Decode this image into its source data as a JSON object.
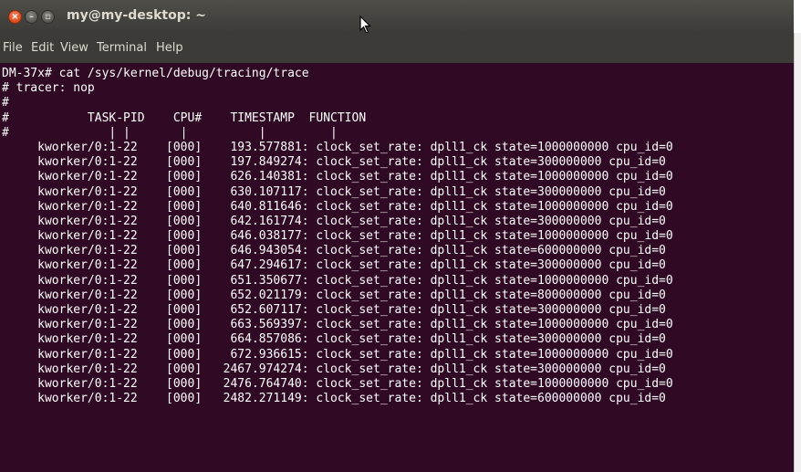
{
  "window": {
    "title": "my@my-desktop: ~",
    "close_icon": "close-icon",
    "minimize_icon": "minimize-icon",
    "maximize_icon": "maximize-icon"
  },
  "menu": [
    "File",
    "Edit",
    "View",
    "Terminal",
    "Help"
  ],
  "terminal": {
    "background": "#300a24",
    "lines": [
      "DM-37x# cat /sys/kernel/debug/tracing/trace",
      "# tracer: nop",
      "#",
      "#           TASK-PID    CPU#    TIMESTAMP  FUNCTION",
      "#              | |       |          |         |",
      "     kworker/0:1-22    [000]    193.577881: clock_set_rate: dpll1_ck state=1000000000 cpu_id=0",
      "     kworker/0:1-22    [000]    197.849274: clock_set_rate: dpll1_ck state=300000000 cpu_id=0",
      "     kworker/0:1-22    [000]    626.140381: clock_set_rate: dpll1_ck state=1000000000 cpu_id=0",
      "     kworker/0:1-22    [000]    630.107117: clock_set_rate: dpll1_ck state=300000000 cpu_id=0",
      "     kworker/0:1-22    [000]    640.811646: clock_set_rate: dpll1_ck state=1000000000 cpu_id=0",
      "     kworker/0:1-22    [000]    642.161774: clock_set_rate: dpll1_ck state=300000000 cpu_id=0",
      "     kworker/0:1-22    [000]    646.038177: clock_set_rate: dpll1_ck state=1000000000 cpu_id=0",
      "     kworker/0:1-22    [000]    646.943054: clock_set_rate: dpll1_ck state=600000000 cpu_id=0",
      "     kworker/0:1-22    [000]    647.294617: clock_set_rate: dpll1_ck state=300000000 cpu_id=0",
      "     kworker/0:1-22    [000]    651.350677: clock_set_rate: dpll1_ck state=1000000000 cpu_id=0",
      "     kworker/0:1-22    [000]    652.021179: clock_set_rate: dpll1_ck state=800000000 cpu_id=0",
      "     kworker/0:1-22    [000]    652.607117: clock_set_rate: dpll1_ck state=300000000 cpu_id=0",
      "     kworker/0:1-22    [000]    663.569397: clock_set_rate: dpll1_ck state=1000000000 cpu_id=0",
      "     kworker/0:1-22    [000]    664.857086: clock_set_rate: dpll1_ck state=300000000 cpu_id=0",
      "     kworker/0:1-22    [000]    672.936615: clock_set_rate: dpll1_ck state=1000000000 cpu_id=0",
      "     kworker/0:1-22    [000]   2467.974274: clock_set_rate: dpll1_ck state=300000000 cpu_id=0",
      "     kworker/0:1-22    [000]   2476.764740: clock_set_rate: dpll1_ck state=1000000000 cpu_id=0",
      "     kworker/0:1-22    [000]   2482.271149: clock_set_rate: dpll1_ck state=600000000 cpu_id=0"
    ]
  }
}
